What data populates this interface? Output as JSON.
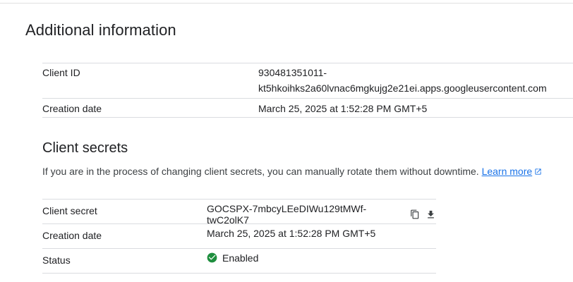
{
  "additional_info": {
    "title": "Additional information",
    "client_id_label": "Client ID",
    "client_id_line1": "930481351011-",
    "client_id_line2": "kt5hkoihks2a60lvnac6mgkujg2e21ei.apps.googleusercontent.com",
    "creation_date_label": "Creation date",
    "creation_date_value": "March 25, 2025 at 1:52:28 PM GMT+5"
  },
  "client_secrets": {
    "title": "Client secrets",
    "description": "If you are in the process of changing client secrets, you can manually rotate them without downtime.",
    "learn_more": "Learn more",
    "secret_label": "Client secret",
    "secret_value": "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",
    "creation_date_label": "Creation date",
    "creation_date_value": "March 25, 2025 at 1:52:28 PM GMT+5",
    "status_label": "Status",
    "status_value": "Enabled"
  },
  "colors": {
    "link": "#1a73e8",
    "enabled_green": "#1e8e3e",
    "divider": "#dadce0"
  },
  "icons": {
    "copy": "copy-icon",
    "download": "download-icon",
    "external": "open-in-new-icon",
    "status": "check-circle-icon"
  }
}
